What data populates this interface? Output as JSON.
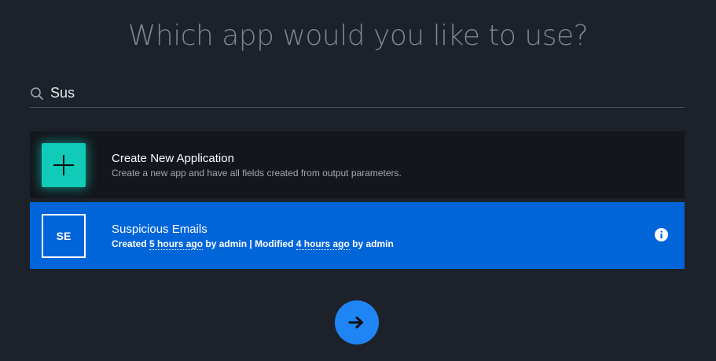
{
  "heading": "Which app would you like to use?",
  "search": {
    "value": "Sus",
    "icon": "search-icon"
  },
  "create_card": {
    "title": "Create New Application",
    "subtitle": "Create a new app and have all fields created from output parameters.",
    "icon": "plus-icon",
    "accent": "#10cbb7"
  },
  "app_card": {
    "initials": "SE",
    "title": "Suspicious Emails",
    "created_prefix": "Created",
    "created_time": "5 hours ago",
    "created_by": "by admin | Modified",
    "modified_time": "4 hours ago",
    "modified_by": "by admin",
    "icon": "info-icon",
    "accent": "#0065d9"
  },
  "next_button": {
    "icon": "arrow-right-icon",
    "color": "#1f85f5"
  }
}
